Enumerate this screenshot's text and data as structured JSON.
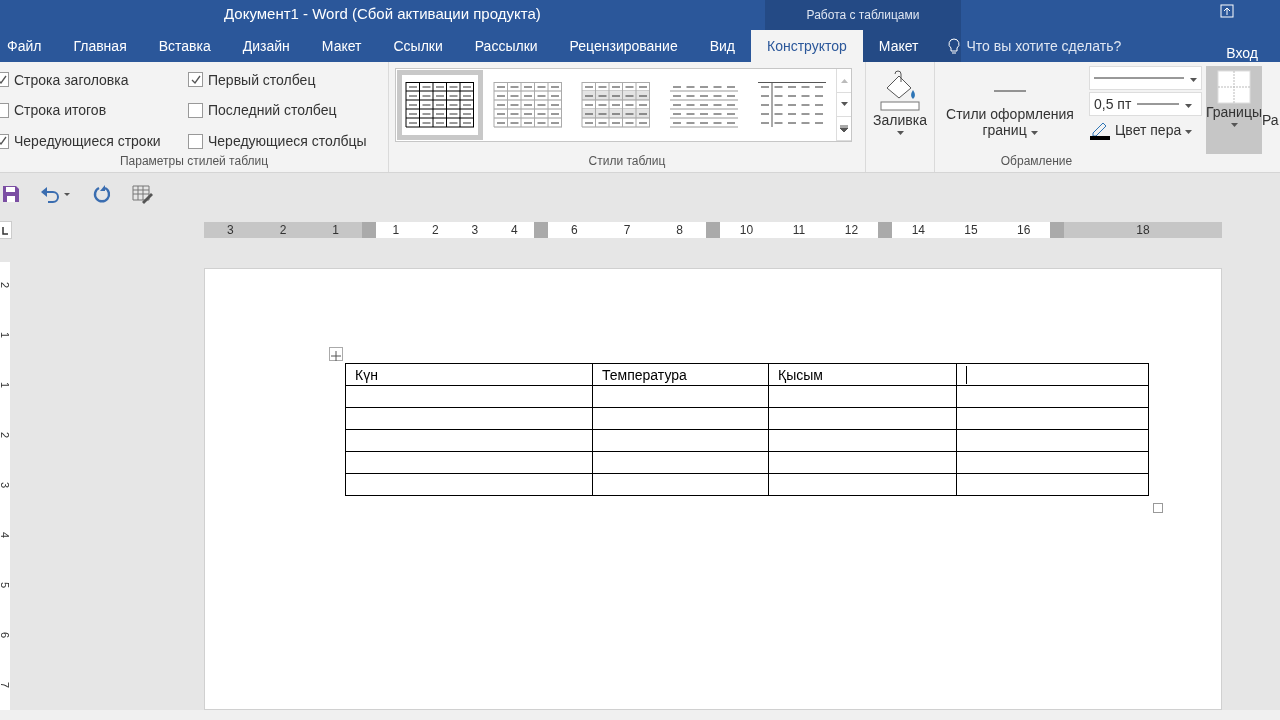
{
  "window": {
    "title": "Документ1 - Word (Сбой активации продукта)",
    "context_label": "Работа с таблицами"
  },
  "tabs": [
    {
      "label": "Файл",
      "selected": false
    },
    {
      "label": "Главная",
      "selected": false
    },
    {
      "label": "Вставка",
      "selected": false
    },
    {
      "label": "Дизайн",
      "selected": false
    },
    {
      "label": "Макет",
      "selected": false
    },
    {
      "label": "Ссылки",
      "selected": false
    },
    {
      "label": "Рассылки",
      "selected": false
    },
    {
      "label": "Рецензирование",
      "selected": false
    },
    {
      "label": "Вид",
      "selected": false
    },
    {
      "label": "Конструктор",
      "selected": true
    },
    {
      "label": "Макет",
      "selected": false
    }
  ],
  "tell_me": {
    "placeholder": "Что вы хотите сделать?"
  },
  "sign_in": "Вход",
  "style_options": {
    "label": "Параметры стилей таблиц",
    "options": [
      {
        "label": "Строка заголовка",
        "checked": true
      },
      {
        "label": "Первый столбец",
        "checked": true
      },
      {
        "label": "Строка итогов",
        "checked": false
      },
      {
        "label": "Последний столбец",
        "checked": false
      },
      {
        "label": "Чередующиеся строки",
        "checked": true
      },
      {
        "label": "Чередующиеся столбцы",
        "checked": false
      }
    ]
  },
  "table_styles": {
    "label": "Стили таблиц",
    "styles": [
      {
        "kind": "grid",
        "selected": true
      },
      {
        "kind": "light-grid",
        "selected": false
      },
      {
        "kind": "shaded-grid",
        "selected": false
      },
      {
        "kind": "lines",
        "selected": false
      },
      {
        "kind": "first-column",
        "selected": false
      }
    ]
  },
  "shading": {
    "label": "Заливка"
  },
  "borders": {
    "label": "Обрамление",
    "border_styles": "Стили оформления границ",
    "weight": "0,5 пт",
    "pen_color": "Цвет пера",
    "borders_button": "Границы",
    "cut_button": "Ра"
  },
  "ruler": {
    "segments": [
      {
        "kind": "margin",
        "labels": [
          "3",
          "2",
          "1"
        ]
      },
      {
        "kind": "text",
        "labels": [
          "1",
          "2",
          "3",
          "4"
        ]
      },
      {
        "kind": "text",
        "labels": [
          "6",
          "7",
          "8"
        ]
      },
      {
        "kind": "text",
        "labels": [
          "10",
          "11",
          "12"
        ]
      },
      {
        "kind": "text",
        "labels": [
          "14",
          "15",
          "16"
        ]
      },
      {
        "kind": "margin",
        "labels": [
          "18"
        ]
      }
    ],
    "vertical_labels": [
      "2",
      "1",
      "1",
      "2",
      "3",
      "4",
      "5",
      "6",
      "7"
    ]
  },
  "table": {
    "columns": [
      {
        "kind": "header",
        "label": "Күн"
      },
      {
        "kind": "header",
        "label": "Температура"
      },
      {
        "kind": "header",
        "label": "Қысым"
      },
      {
        "kind": "empty"
      }
    ],
    "rows": [
      {
        "kind": "empty"
      },
      {
        "kind": "empty"
      },
      {
        "kind": "empty"
      },
      {
        "kind": "empty"
      },
      {
        "kind": "empty"
      }
    ]
  }
}
